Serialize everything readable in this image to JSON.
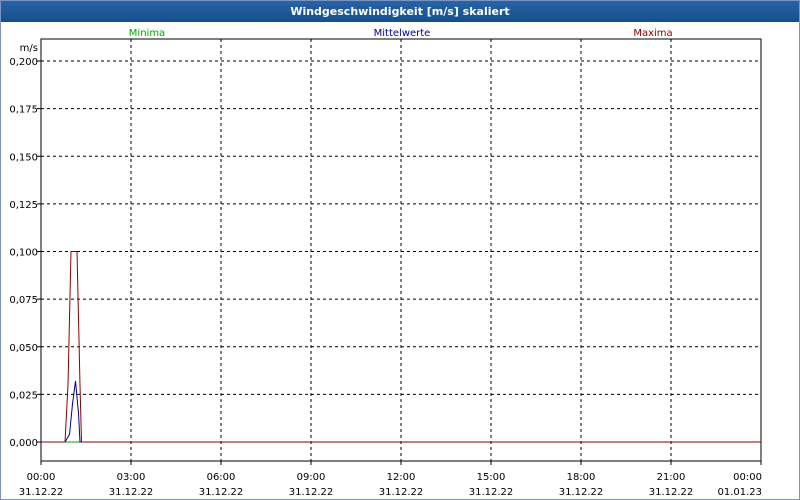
{
  "window": {
    "title": "Windgeschwindigkeit [m/s] skaliert"
  },
  "colors": {
    "minima": "#00aa00",
    "mittelwerte": "#00008b",
    "maxima": "#8b0000",
    "titlebar": "#1a5a9c"
  },
  "chart_data": {
    "type": "line",
    "title": "Windgeschwindigkeit [m/s] skaliert",
    "ylabel": "m/s",
    "xlabel": "",
    "ylim": [
      0.0,
      0.2
    ],
    "y_ticks": [
      "0,000",
      "0,025",
      "0,050",
      "0,075",
      "0,100",
      "0,125",
      "0,150",
      "0,175",
      "0,200"
    ],
    "x_tick_times": [
      "00:00",
      "03:00",
      "06:00",
      "09:00",
      "12:00",
      "15:00",
      "18:00",
      "21:00",
      "00:00"
    ],
    "x_tick_dates": [
      "31.12.22",
      "31.12.22",
      "31.12.22",
      "31.12.22",
      "31.12.22",
      "31.12.22",
      "31.12.22",
      "31.12.22",
      "01.01.23"
    ],
    "xlim_hours": [
      0,
      24
    ],
    "grid": true,
    "legend_position": "top",
    "series": [
      {
        "name": "Minima",
        "color": "#00aa00",
        "x_hours": [
          0,
          24
        ],
        "values": [
          0.0,
          0.0
        ]
      },
      {
        "name": "Mittelwerte",
        "color": "#00008b",
        "x_hours": [
          0,
          0.8,
          0.95,
          1.05,
          1.15,
          1.25,
          1.3,
          24
        ],
        "values": [
          0.0,
          0.0,
          0.004,
          0.02,
          0.032,
          0.015,
          0.0,
          0.0
        ]
      },
      {
        "name": "Maxima",
        "color": "#8b0000",
        "x_hours": [
          0,
          0.8,
          0.9,
          1.0,
          1.2,
          1.3,
          1.35,
          24
        ],
        "values": [
          0.0,
          0.0,
          0.03,
          0.1,
          0.1,
          0.03,
          0.0,
          0.0
        ]
      }
    ]
  }
}
